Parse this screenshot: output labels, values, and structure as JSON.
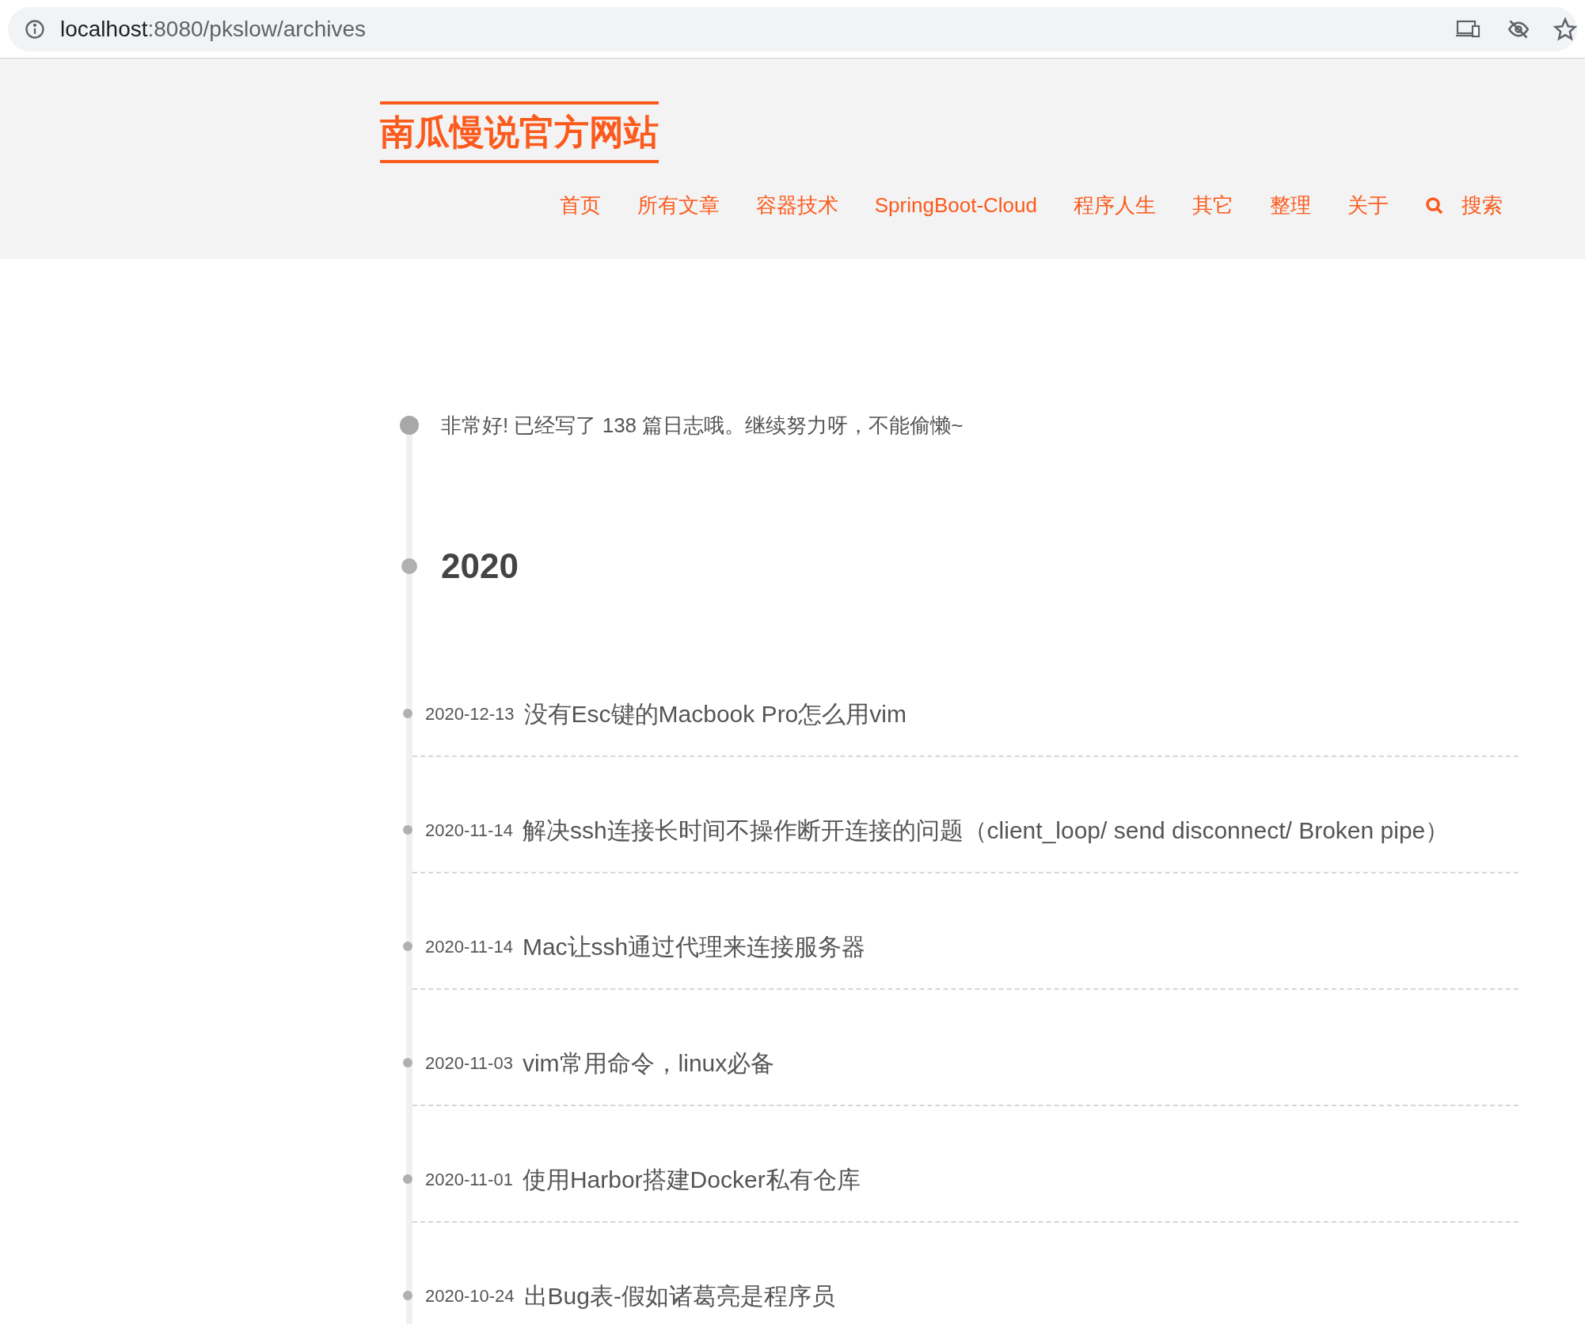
{
  "browser": {
    "host": "localhost",
    "path": ":8080/pkslow/archives"
  },
  "site": {
    "title": "南瓜慢说官方网站"
  },
  "nav": [
    {
      "label": "首页"
    },
    {
      "label": "所有文章"
    },
    {
      "label": "容器技术"
    },
    {
      "label": "SpringBoot-Cloud"
    },
    {
      "label": "程序人生"
    },
    {
      "label": "其它"
    },
    {
      "label": "整理"
    },
    {
      "label": "关于"
    }
  ],
  "search": {
    "label": "搜索"
  },
  "archive": {
    "summary": "非常好! 已经写了 138 篇日志哦。继续努力呀，不能偷懒~",
    "year": "2020",
    "posts": [
      {
        "date": "2020-12-13",
        "title": "没有Esc键的Macbook Pro怎么用vim"
      },
      {
        "date": "2020-11-14",
        "title": "解决ssh连接长时间不操作断开连接的问题（client_loop/ send disconnect/ Broken pipe）"
      },
      {
        "date": "2020-11-14",
        "title": "Mac让ssh通过代理来连接服务器"
      },
      {
        "date": "2020-11-03",
        "title": "vim常用命令，linux必备"
      },
      {
        "date": "2020-11-01",
        "title": "使用Harbor搭建Docker私有仓库"
      },
      {
        "date": "2020-10-24",
        "title": "出Bug表-假如诸葛亮是程序员"
      }
    ]
  }
}
